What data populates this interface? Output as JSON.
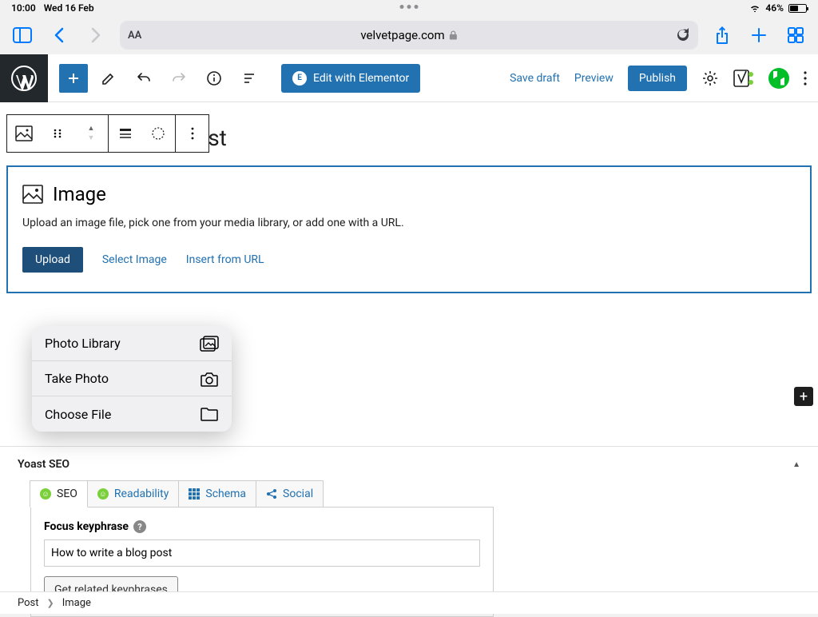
{
  "status": {
    "time": "10:00",
    "date": "Wed 16 Feb",
    "battery_pct": "46%"
  },
  "safari": {
    "url": "velvetpage.com"
  },
  "wp_toolbar": {
    "elementor": "Edit with Elementor",
    "save_draft": "Save draft",
    "preview": "Preview",
    "publish": "Publish"
  },
  "post": {
    "title_fragment": "v post"
  },
  "image_block": {
    "title": "Image",
    "desc": "Upload an image file, pick one from your media library, or add one with a URL.",
    "upload": "Upload",
    "select": "Select Image",
    "insert_url": "Insert from URL"
  },
  "file_picker": {
    "photo_library": "Photo Library",
    "take_photo": "Take Photo",
    "choose_file": "Choose File"
  },
  "yoast": {
    "panel_title": "Yoast SEO",
    "tabs": {
      "seo": "SEO",
      "readability": "Readability",
      "schema": "Schema",
      "social": "Social"
    },
    "focus_label": "Focus keyphrase",
    "focus_value": "How to write a blog post",
    "related_btn": "Get related keyphrases"
  },
  "breadcrumb": {
    "root": "Post",
    "current": "Image"
  }
}
